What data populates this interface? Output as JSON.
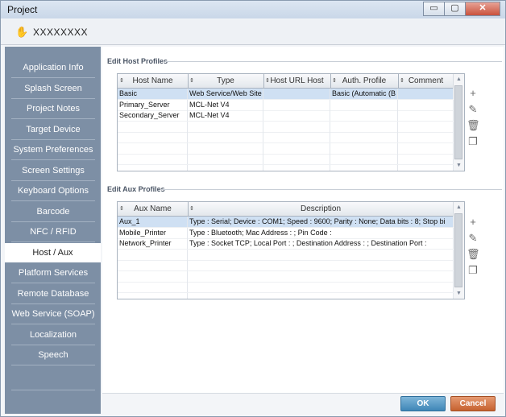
{
  "window": {
    "title": "Project",
    "controls": {
      "minimize": "▭",
      "maximize": "▢",
      "close": "✕"
    }
  },
  "project": {
    "name": "XXXXXXXX",
    "icon": "hand-icon"
  },
  "sidebar": {
    "items": [
      {
        "label": "Application Info"
      },
      {
        "label": "Splash Screen"
      },
      {
        "label": "Project Notes"
      },
      {
        "label": "Target Device"
      },
      {
        "label": "System Preferences"
      },
      {
        "label": "Screen Settings"
      },
      {
        "label": "Keyboard Options"
      },
      {
        "label": "Barcode"
      },
      {
        "label": "NFC / RFID"
      },
      {
        "label": "Host / Aux",
        "active": true
      },
      {
        "label": "Platform Services"
      },
      {
        "label": "Remote Database"
      },
      {
        "label": "Web Service (SOAP)"
      },
      {
        "label": "Localization"
      },
      {
        "label": "Speech"
      }
    ]
  },
  "host_profiles": {
    "section_label": "Edit Host Profiles",
    "columns": [
      "Host Name",
      "Type",
      "Host URL Host",
      "Auth. Profile",
      "Comment"
    ],
    "rows": [
      [
        "Basic",
        "Web Service/Web Site",
        "",
        "Basic (Automatic (B",
        ""
      ],
      [
        "Primary_Server",
        "MCL-Net V4",
        "",
        "",
        ""
      ],
      [
        "Secondary_Server",
        "MCL-Net V4",
        "",
        "",
        ""
      ]
    ]
  },
  "aux_profiles": {
    "section_label": "Edit Aux Profiles",
    "columns": [
      "Aux Name",
      "Description"
    ],
    "rows": [
      [
        "Aux_1",
        "Type : Serial; Device : COM1; Speed : 9600; Parity : None; Data bits : 8; Stop bi"
      ],
      [
        "Mobile_Printer",
        "Type : Bluetooth; Mac Address : ; Pin Code :"
      ],
      [
        "Network_Printer",
        "Type : Socket TCP; Local Port : ; Destination Address : ; Destination Port :"
      ]
    ]
  },
  "toolbar_icons": {
    "add": "+",
    "edit": "✎",
    "delete": "🗑",
    "copy": "❐"
  },
  "footer": {
    "ok_label": "OK",
    "cancel_label": "Cancel"
  }
}
